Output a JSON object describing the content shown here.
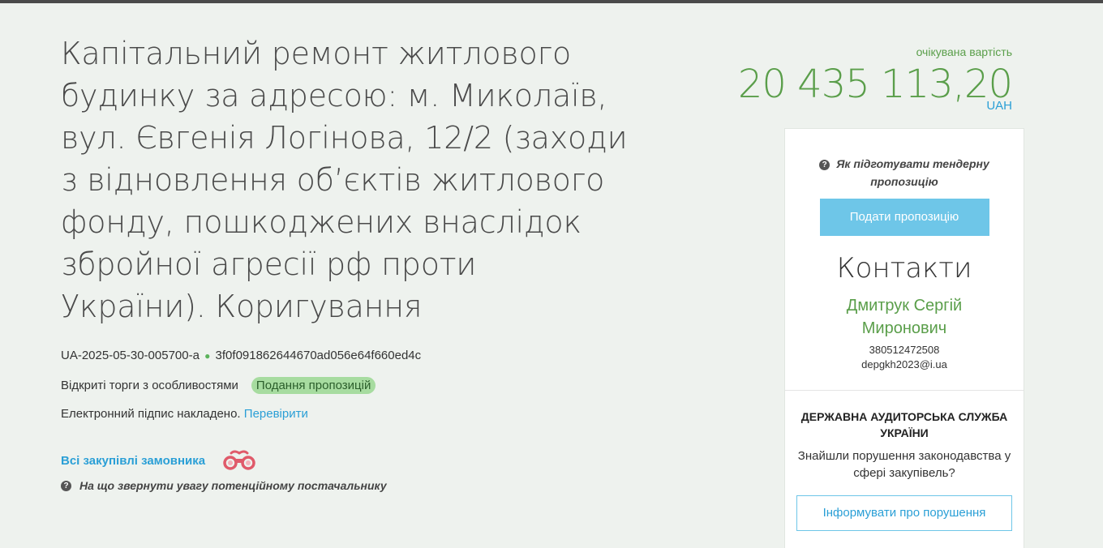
{
  "tender": {
    "title": "Капітальний ремонт житлового будинку за адресою: м. Миколаїв, вул. Євгенія Логінова, 12/2 (заходи з відновлення об’єктів житлового фонду, пошкоджених внаслідок збройної агресії рф проти України). Коригування",
    "tender_id": "UA-2025-05-30-005700-a",
    "hash": "3f0f091862644670ad056e64f660ed4c",
    "procedure_type": "Відкриті торги з особливостями",
    "status_badge": "Подання пропозицій",
    "signature_text": "Електронний підпис накладено.",
    "signature_link": "Перевірити",
    "all_purchases_link": "Всі закупівлі замовника",
    "supplier_hint": "На що звернути увагу потенційному постачальнику"
  },
  "value": {
    "label": "очікувана вартість",
    "amount": "20 435 113,20",
    "currency": "UAH"
  },
  "card": {
    "how_to_prepare": "Як підготувати тендерну пропозицію",
    "submit_button": "Подати пропозицію",
    "contacts_title": "Контакти",
    "contact_name": "Дмитрук Сергій Миронович",
    "contact_phone": "380512472508",
    "contact_email": "depgkh2023@i.ua",
    "dasu_title": "ДЕРЖАВНА АУДИТОРСЬКА СЛУЖБА УКРАЇНИ",
    "dasu_text": "Знайшли порушення законодавства у сфері закупівель?",
    "report_button": "Інформувати про порушення"
  },
  "colors": {
    "accent_green": "#5a9e4a",
    "link_blue": "#2a9fd6",
    "button_blue": "#6ec6e8",
    "badge_green": "#a7dca0"
  }
}
